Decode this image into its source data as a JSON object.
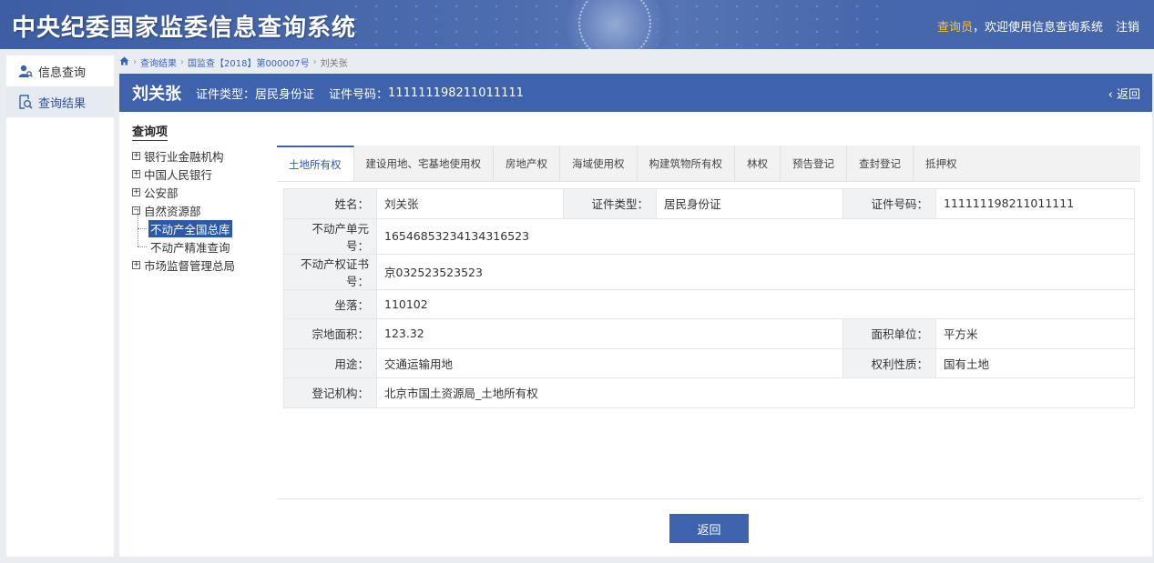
{
  "header": {
    "title": "中央纪委国家监委信息查询系统",
    "user_role": "查询员",
    "welcome": "，欢迎使用信息查询系统",
    "logout": "注销"
  },
  "nav": {
    "items": [
      {
        "label": "信息查询",
        "icon": "user-search-icon"
      },
      {
        "label": "查询结果",
        "icon": "doc-search-icon"
      }
    ]
  },
  "breadcrumb": {
    "items": [
      "查询结果",
      "国监查【2018】第000007号",
      "刘关张"
    ]
  },
  "subject": {
    "name": "刘关张",
    "id_type_label": "证件类型：",
    "id_type": "居民身份证",
    "id_no_label": "证件号码：",
    "id_no": "111111198211011111",
    "back": "返回"
  },
  "tree": {
    "header": "查询项",
    "nodes": [
      {
        "label": "银行业金融机构",
        "toggle": "+"
      },
      {
        "label": "中国人民银行",
        "toggle": "+"
      },
      {
        "label": "公安部",
        "toggle": "+"
      },
      {
        "label": "自然资源部",
        "toggle": "−"
      },
      {
        "label": "不动产全国总库",
        "selected": true
      },
      {
        "label": "不动产精准查询"
      },
      {
        "label": "市场监督管理总局",
        "toggle": "+"
      }
    ]
  },
  "tabs": [
    "土地所有权",
    "建设用地、宅基地使用权",
    "房地产权",
    "海域使用权",
    "构建筑物所有权",
    "林权",
    "预告登记",
    "查封登记",
    "抵押权"
  ],
  "detail": {
    "name_label": "姓名：",
    "name": "刘关张",
    "idtype_label": "证件类型：",
    "idtype": "居民身份证",
    "idno_label": "证件号码：",
    "idno": "111111198211011111",
    "unit_label": "不动产单元号：",
    "unit": "16546853234134316523",
    "cert_label": "不动产权证书号：",
    "cert": "京032523523523",
    "loc_label": "坐落：",
    "loc": "110102",
    "area_label": "宗地面积：",
    "area": "123.32",
    "areaunit_label": "面积单位：",
    "areaunit": "平方米",
    "use_label": "用途：",
    "use": "交通运输用地",
    "nature_label": "权利性质：",
    "nature": "国有土地",
    "org_label": "登记机构：",
    "org": "北京市国土资源局_土地所有权"
  },
  "footer": {
    "back_button": "返回"
  },
  "colors": {
    "primary": "#3f62ad",
    "accent": "#f5c340"
  }
}
